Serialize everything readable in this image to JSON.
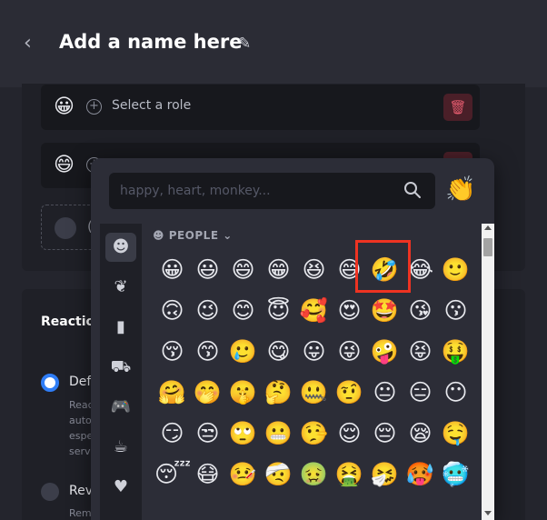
{
  "header": {
    "back_icon": "chevron-left-icon",
    "title": "Add a name here",
    "edit_icon": "pencil-icon"
  },
  "roles": {
    "rows": [
      {
        "emoji": "😀",
        "label": "Select a role"
      },
      {
        "emoji": "😄"
      },
      {
        "label": "("
      }
    ],
    "delete_icon": "trash-icon"
  },
  "reactions": {
    "title": "Reactio",
    "options": [
      {
        "label": "Def",
        "selected": true,
        "desc": [
          "Reac",
          "auto",
          "espe",
          "serv"
        ]
      },
      {
        "label": "Rev",
        "selected": false,
        "desc": [
          "Rem"
        ]
      }
    ]
  },
  "picker": {
    "search_placeholder": "happy, heart, monkey...",
    "search_icon": "search-icon",
    "skin_tone_emoji": "👏",
    "categories": [
      {
        "name": "people",
        "icon": "☻"
      },
      {
        "name": "nature",
        "icon": "❦"
      },
      {
        "name": "food",
        "icon": "▮"
      },
      {
        "name": "travel",
        "icon": "⛟"
      },
      {
        "name": "activities",
        "icon": "🎮"
      },
      {
        "name": "objects",
        "icon": "☕"
      },
      {
        "name": "symbols",
        "icon": "♥"
      }
    ],
    "section": "☻ PEOPLE ⌄",
    "emojis": [
      "😀",
      "😃",
      "😄",
      "😁",
      "😆",
      "😅",
      "🤣",
      "😂",
      "🙂",
      "🙃",
      "😉",
      "😊",
      "😇",
      "🥰",
      "😍",
      "🤩",
      "😘",
      "😗",
      "😚",
      "😙",
      "🥲",
      "😋",
      "😛",
      "😜",
      "🤪",
      "😝",
      "🤑",
      "🤗",
      "🤭",
      "🤫",
      "🤔",
      "🤐",
      "🤨",
      "😐",
      "😑",
      "😶",
      "😏",
      "😒",
      "🙄",
      "😬",
      "🤥",
      "😌",
      "😔",
      "😪",
      "🤤",
      "😴",
      "😷",
      "🤒",
      "🤕",
      "🤢",
      "🤮",
      "🤧",
      "🥵",
      "🥶"
    ],
    "highlight_color": "#ee3322"
  }
}
